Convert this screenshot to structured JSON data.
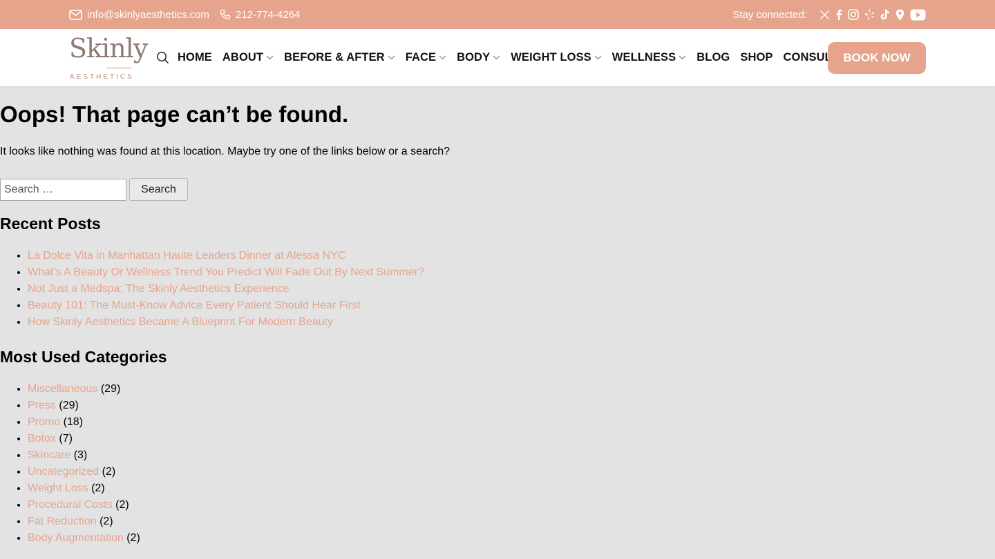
{
  "topbar": {
    "email": "info@skinlyaesthetics.com",
    "phone": "212-774-4264",
    "stay_connected": "Stay connected:",
    "social_icons": [
      "x-icon",
      "facebook-icon",
      "instagram-icon",
      "yelp-icon",
      "tiktok-icon",
      "location-pin-icon",
      "youtube-icon"
    ]
  },
  "logo": {
    "wordmark": "Skinly",
    "subtext": "AESTHETICS"
  },
  "nav": {
    "items": [
      {
        "label": "HOME",
        "dropdown": false
      },
      {
        "label": "ABOUT",
        "dropdown": true
      },
      {
        "label": "BEFORE & AFTER",
        "dropdown": true
      },
      {
        "label": "FACE",
        "dropdown": true
      },
      {
        "label": "BODY",
        "dropdown": true
      },
      {
        "label": "WEIGHT LOSS",
        "dropdown": true
      },
      {
        "label": "WELLNESS",
        "dropdown": true
      },
      {
        "label": "BLOG",
        "dropdown": false
      },
      {
        "label": "SHOP",
        "dropdown": false
      },
      {
        "label": "CONSULT",
        "dropdown": false
      }
    ],
    "cta": "BOOK NOW"
  },
  "main": {
    "title": "Oops! That page can’t be found.",
    "description": "It looks like nothing was found at this location. Maybe try one of the links below or a search?",
    "search": {
      "placeholder": "Search …",
      "value": "",
      "button": "Search"
    },
    "recent_posts_title": "Recent Posts",
    "recent_posts": [
      "La Dolce Vita in Manhattan Haute Leaders Dinner at Alessa NYC",
      "What’s A Beauty Or Wellness Trend You Predict Will Fade Out By Next Summer?",
      "Not Just a Medspa: The Skinly Aesthetics Experience",
      "Beauty 101: The Must-Know Advice Every Patient Should Hear First",
      "How Skinly Aesthetics Became A Blueprint For Modern Beauty"
    ],
    "categories_title": "Most Used Categories",
    "categories": [
      {
        "name": "Miscellaneous",
        "count": "(29)"
      },
      {
        "name": "Press",
        "count": "(29)"
      },
      {
        "name": "Promo",
        "count": "(18)"
      },
      {
        "name": "Botox",
        "count": "(7)"
      },
      {
        "name": "Skincare",
        "count": "(3)"
      },
      {
        "name": "Uncategorized",
        "count": "(2)"
      },
      {
        "name": "Weight Loss",
        "count": "(2)"
      },
      {
        "name": "Procedural Costs",
        "count": "(2)"
      },
      {
        "name": "Fat Reduction",
        "count": "(2)"
      },
      {
        "name": "Body Augmentation",
        "count": "(2)"
      }
    ]
  },
  "colors": {
    "accent": "#e6a48d",
    "background": "#e3e3e3",
    "logo": "#8f7b73"
  }
}
